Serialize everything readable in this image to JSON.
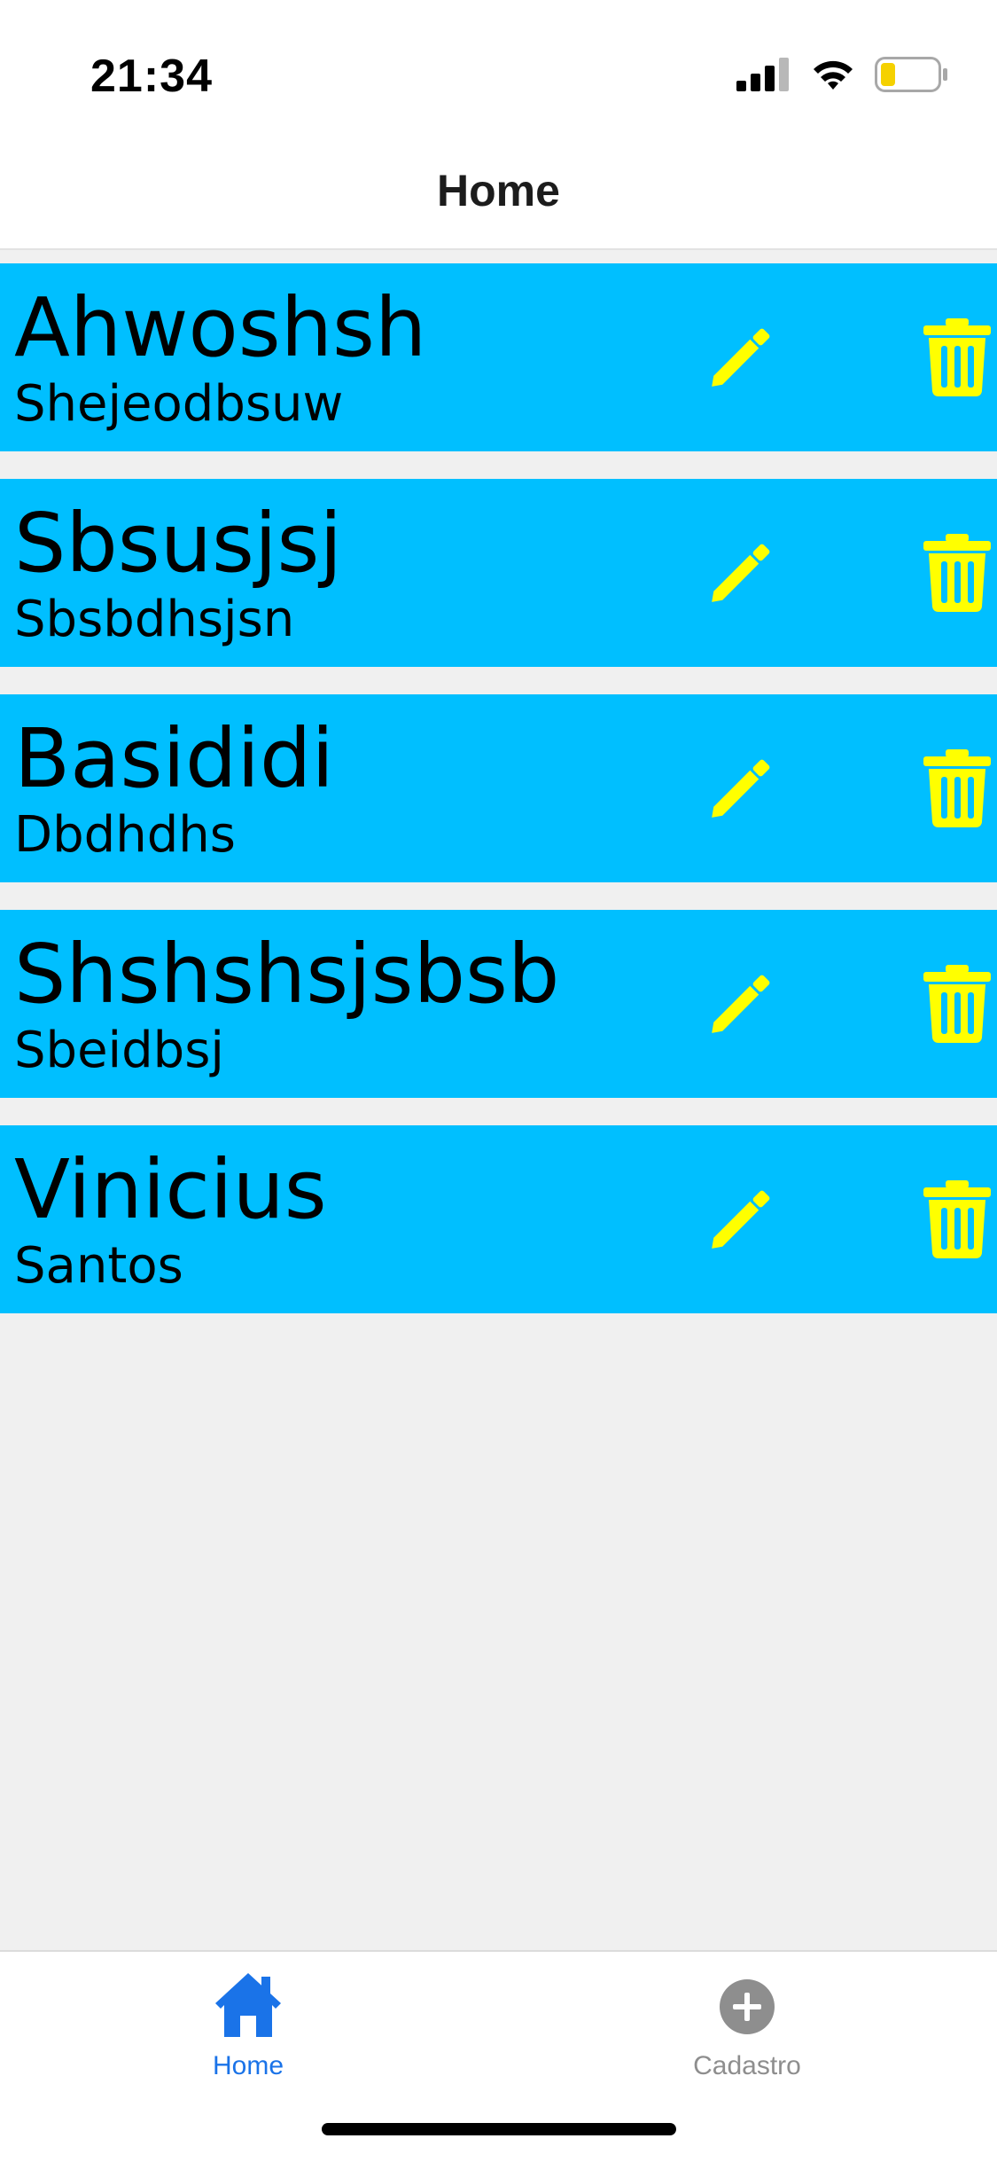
{
  "status_bar": {
    "time": "21:34",
    "icons": [
      "signal-icon",
      "wifi-icon",
      "battery-icon"
    ],
    "battery_color": "#f5d100"
  },
  "header": {
    "title": "Home"
  },
  "list": {
    "card_color": "#00bfff",
    "action_icon_color": "#ffff00",
    "items": [
      {
        "name": "Ahwoshsh",
        "subtitle": "Shejeodbsuw"
      },
      {
        "name": "Sbsusjsj",
        "subtitle": "Sbsbdhsjsn"
      },
      {
        "name": "Basididi",
        "subtitle": "Dbdhdhs"
      },
      {
        "name": "Shshshsjsbsb",
        "subtitle": "Sbeidbsj"
      },
      {
        "name": "Vinicius",
        "subtitle": "Santos"
      }
    ]
  },
  "tab_bar": {
    "tabs": [
      {
        "label": "Home",
        "icon": "home-icon",
        "active": true,
        "color": "#1a73e8"
      },
      {
        "label": "Cadastro",
        "icon": "plus-circle-icon",
        "active": false,
        "color": "#8e8e8e"
      }
    ]
  }
}
